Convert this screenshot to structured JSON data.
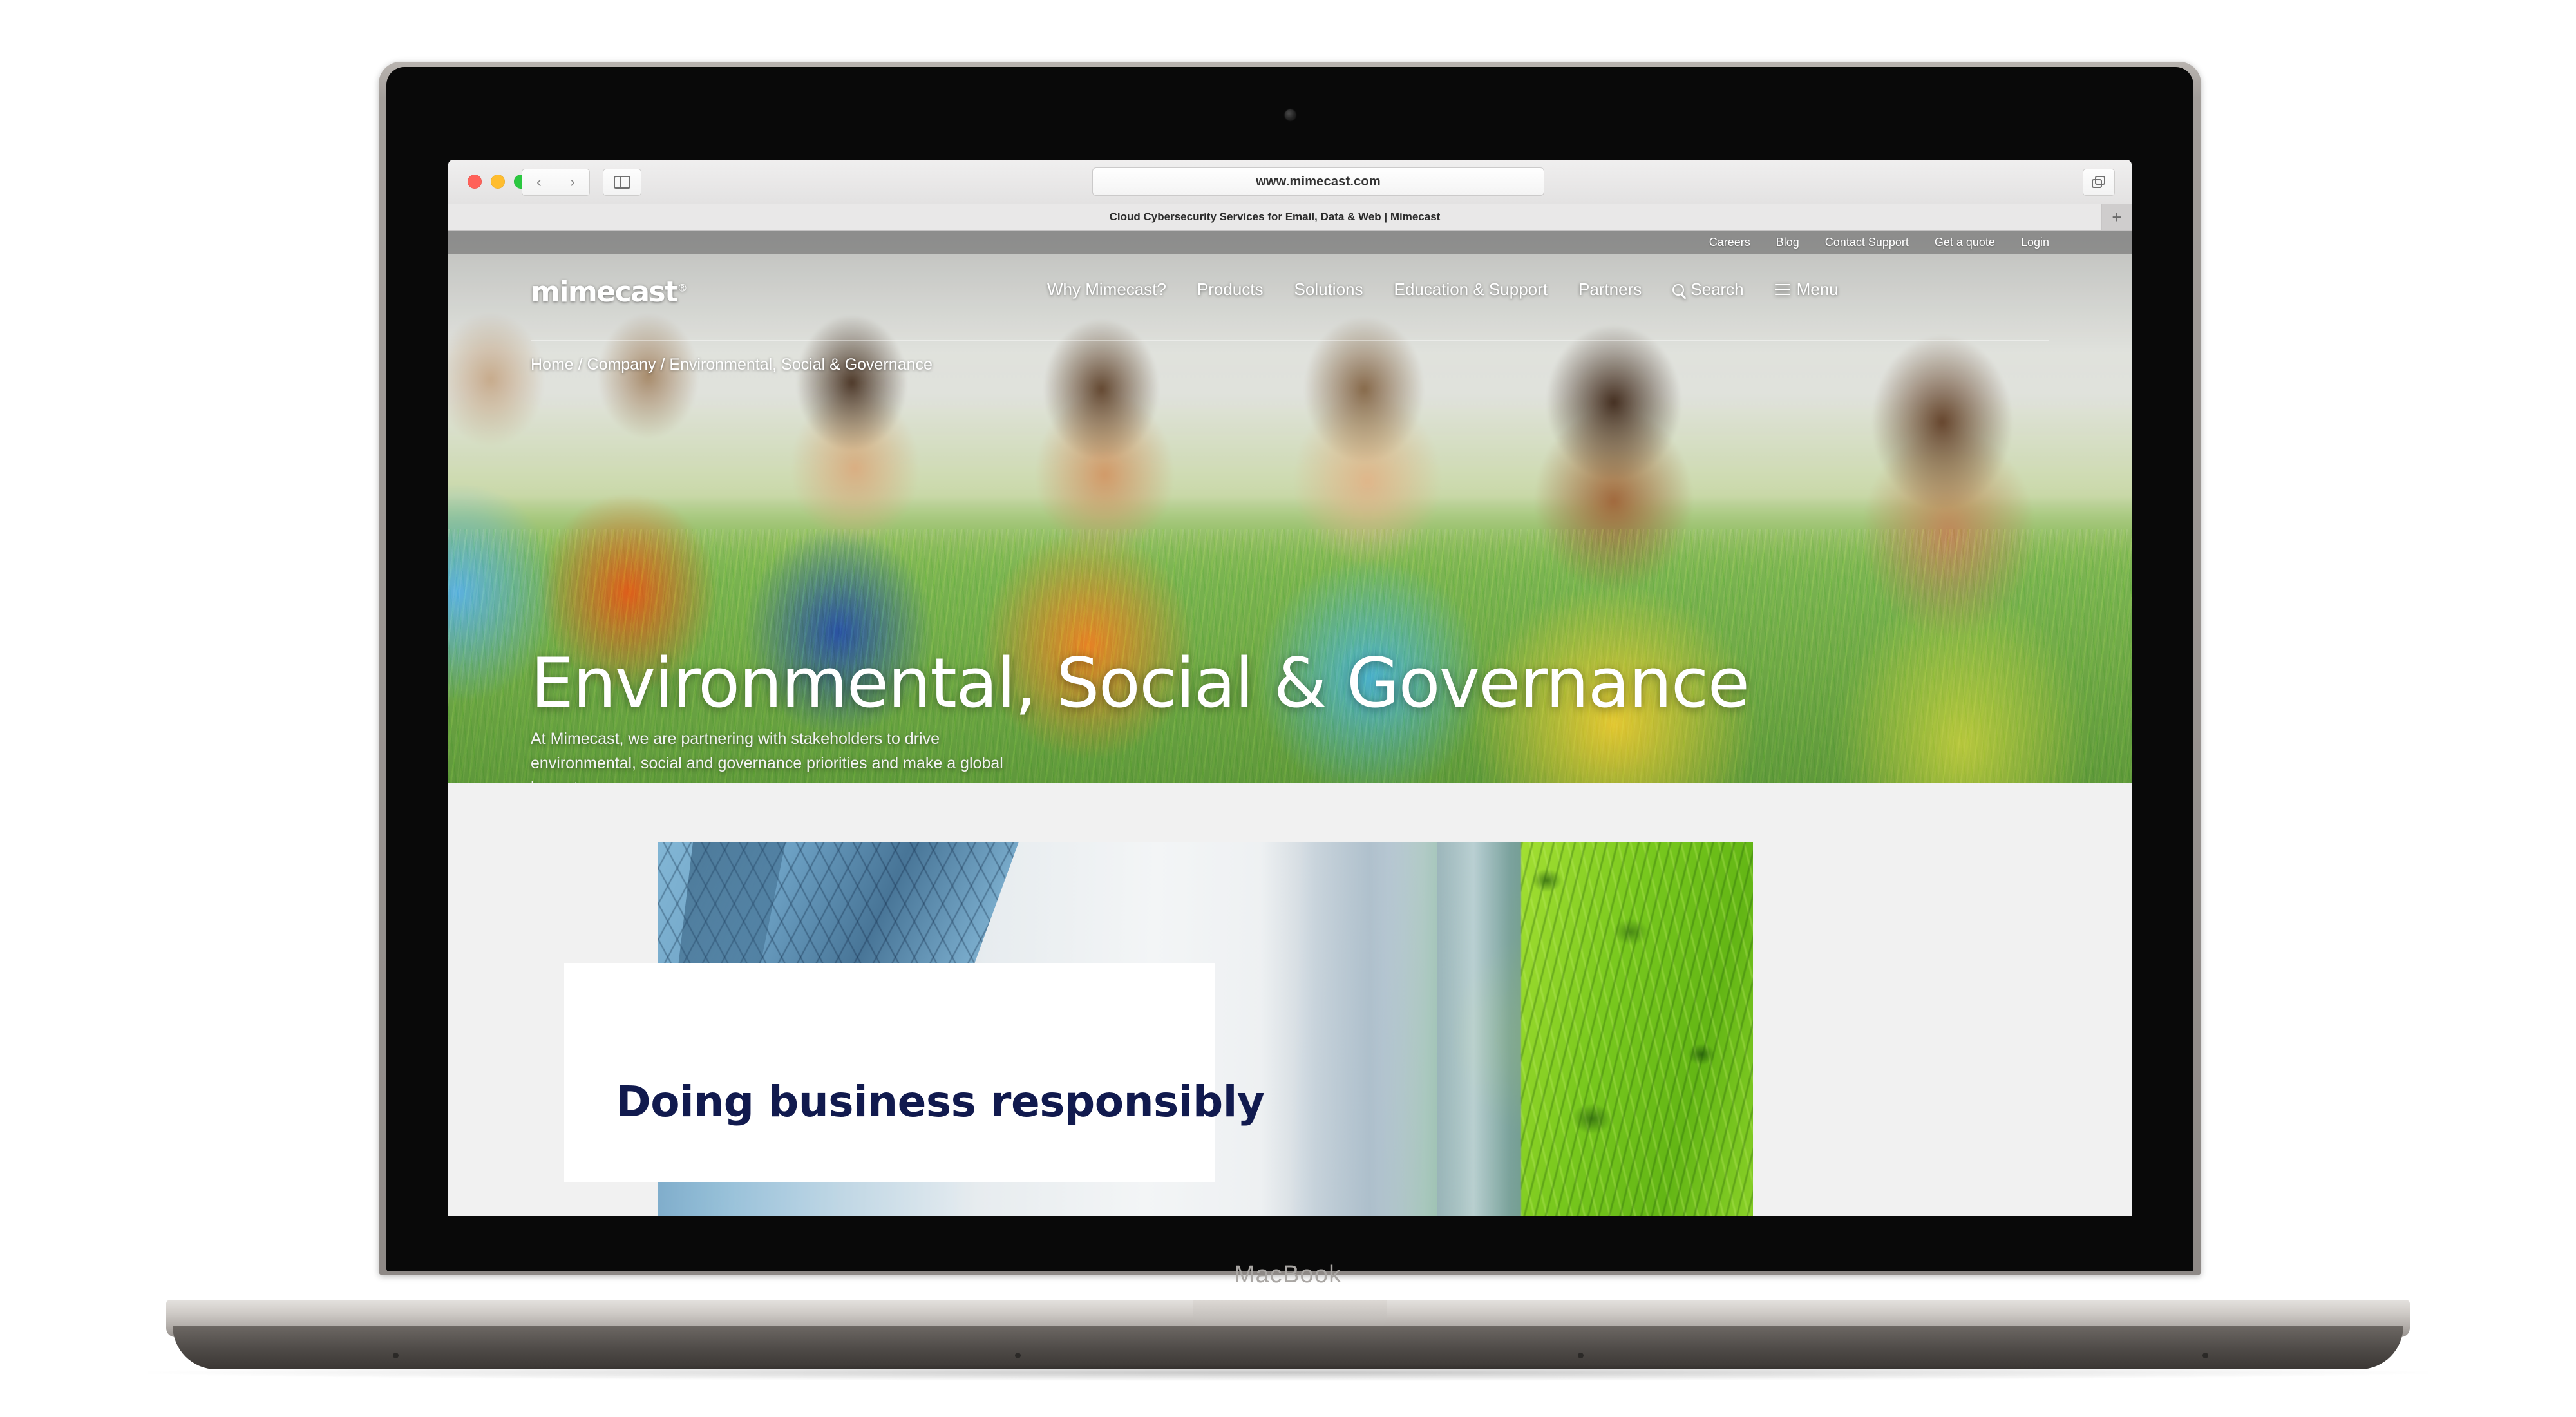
{
  "device": {
    "wordmark": "MacBook"
  },
  "browser": {
    "url": "www.mimecast.com",
    "tab_title": "Cloud Cybersecurity Services for Email, Data & Web | Mimecast",
    "new_tab_label": "+",
    "back_glyph": "‹",
    "forward_glyph": "›"
  },
  "site": {
    "logo": "mimecast",
    "logo_mark": "®",
    "utility_nav": [
      {
        "label": "Careers"
      },
      {
        "label": "Blog"
      },
      {
        "label": "Contact Support"
      },
      {
        "label": "Get a quote"
      },
      {
        "label": "Login"
      }
    ],
    "main_nav": [
      {
        "label": "Why Mimecast?",
        "icon": null
      },
      {
        "label": "Products",
        "icon": null
      },
      {
        "label": "Solutions",
        "icon": null
      },
      {
        "label": "Education & Support",
        "icon": null
      },
      {
        "label": "Partners",
        "icon": null
      },
      {
        "label": "Search",
        "icon": "search-icon"
      },
      {
        "label": "Menu",
        "icon": "hamburger-icon"
      }
    ],
    "breadcrumb": "Home / Company / Environmental, Social & Governance",
    "hero": {
      "title": "Environmental, Social & Governance",
      "subtitle": "At Mimecast, we are partnering with stakeholders to drive environmental, social and governance priorities and make a global impact."
    },
    "section_two": {
      "heading": "Doing business responsibly"
    },
    "colors": {
      "brand_navy": "#111a4e",
      "utility_bar": "#6e6e6e",
      "section_background": "#f1f1f1",
      "card_background": "#ffffff"
    }
  }
}
